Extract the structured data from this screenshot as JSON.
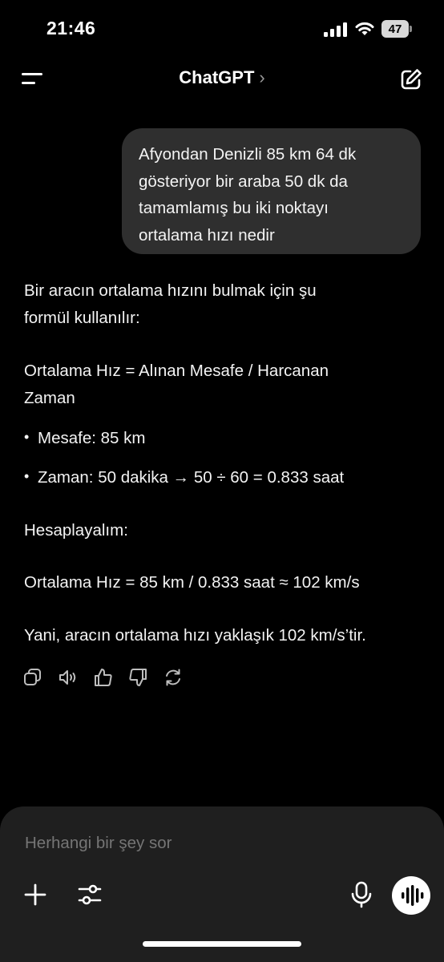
{
  "status_bar": {
    "time": "21:46",
    "battery": "47"
  },
  "header": {
    "title": "ChatGPT",
    "chevron": "›"
  },
  "conversation": {
    "user_message_lines": [
      "Afyondan Denizli 85 km 64 dk",
      "gösteriyor bir araba 50 dk da",
      "tamamlamış bu iki noktayı",
      "ortalama hızı nedir"
    ],
    "assistant": {
      "intro_lines": [
        "Bir aracın ortalama hızını bulmak için şu",
        "formül kullanılır:"
      ],
      "formula_lines": [
        "Ortalama Hız = Alınan Mesafe / Harcanan",
        "Zaman"
      ],
      "bullets": [
        "Mesafe: 85 km",
        "Zaman: 50 dakika → 50 ÷ 60 = 0.833 saat"
      ],
      "bullet_symbol": "•",
      "calc_heading": "Hesaplayalım:",
      "calc_line": "Ortalama Hız = 85 km / 0.833 saat ≈ 102 km/s",
      "conclusion": "Yani, aracın ortalama hızı yaklaşık 102 km/s’tir."
    },
    "actions": [
      "copy-icon",
      "speaker-icon",
      "thumbs-up-icon",
      "thumbs-down-icon",
      "regenerate-icon"
    ]
  },
  "composer": {
    "placeholder": "Herhangi bir şey sor"
  },
  "colors": {
    "background": "#000000",
    "bubble": "#2f2f2f",
    "composer": "#1f1f1f",
    "placeholder": "#8e8e8e"
  }
}
